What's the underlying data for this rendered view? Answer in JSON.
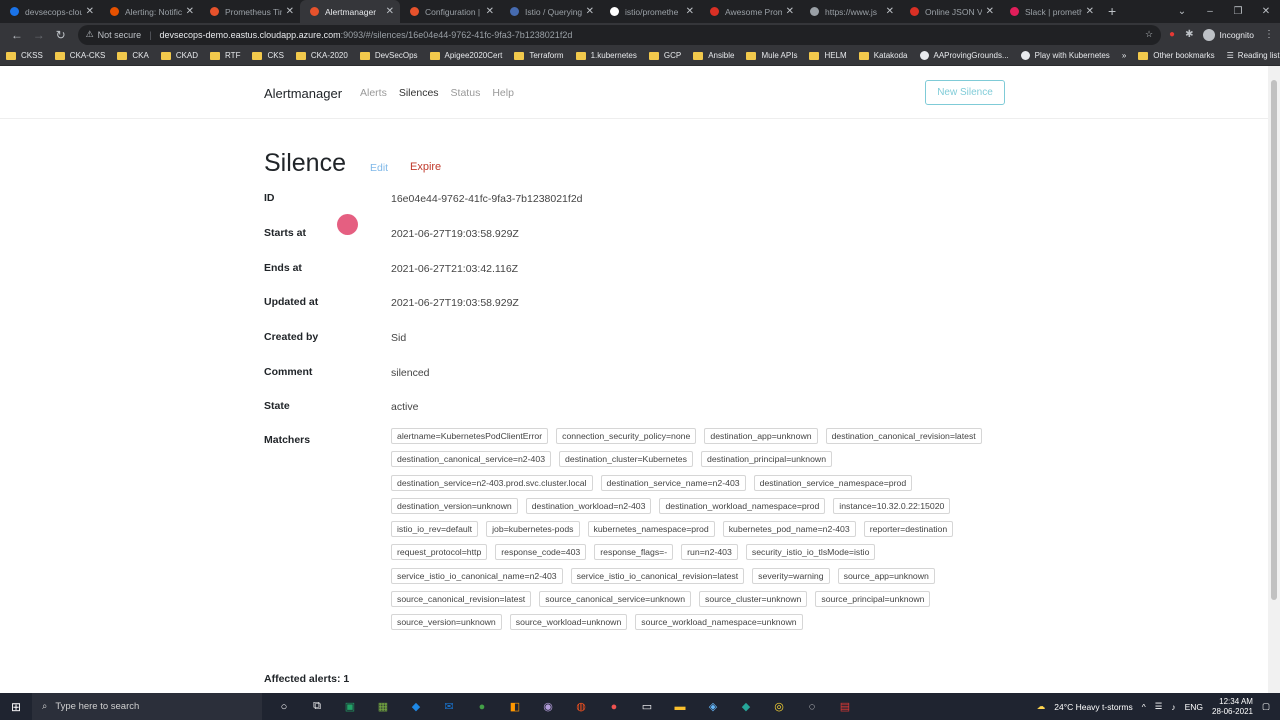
{
  "browser": {
    "tabs": [
      {
        "title": "devsecops-clou",
        "color": "#1a73e8"
      },
      {
        "title": "Alerting: Notific",
        "color": "#e65100"
      },
      {
        "title": "Prometheus Tim",
        "color": "#e6522c"
      },
      {
        "title": "Alertmanager",
        "color": "#e6522c"
      },
      {
        "title": "Configuration |",
        "color": "#e6522c"
      },
      {
        "title": "Istio / Querying",
        "color": "#466bb0"
      },
      {
        "title": "istio/promethe",
        "color": "#ffffff"
      },
      {
        "title": "Awesome Prom",
        "color": "#d93025"
      },
      {
        "title": "https://www.js",
        "color": "#9aa0a6"
      },
      {
        "title": "Online JSON Vie",
        "color": "#d93025"
      },
      {
        "title": "Slack | prometh",
        "color": "#e01e5a"
      }
    ],
    "new_tab": "+",
    "security_label": "Not secure",
    "url_host": "devsecops-demo.eastus.cloudapp.azure.com",
    "url_path": ":9093/#/silences/16e04e44-9762-41fc-9fa3-7b1238021f2d",
    "incognito_label": "Incognito",
    "bookmarks": [
      "CKSS",
      "CKA-CKS",
      "CKA",
      "CKAD",
      "RTF",
      "CKS",
      "CKA-2020",
      "DevSecOps",
      "Apigee2020Cert",
      "Terraform",
      "1.kubernetes",
      "GCP",
      "Ansible",
      "Mule APIs",
      "HELM",
      "Katakoda",
      "AAProvingGrounds...",
      "Play with Kubernetes"
    ],
    "bookmarks_overflow": "»",
    "other_bookmarks": "Other bookmarks",
    "reading_list": "Reading list"
  },
  "nav": {
    "brand": "Alertmanager",
    "links": [
      "Alerts",
      "Silences",
      "Status",
      "Help"
    ],
    "active": "Silences",
    "new_silence": "New Silence"
  },
  "silence": {
    "title": "Silence",
    "edit": "Edit",
    "expire": "Expire",
    "fields": [
      {
        "label": "ID",
        "value": "16e04e44-9762-41fc-9fa3-7b1238021f2d"
      },
      {
        "label": "Starts at",
        "value": "2021-06-27T19:03:58.929Z"
      },
      {
        "label": "Ends at",
        "value": "2021-06-27T21:03:42.116Z"
      },
      {
        "label": "Updated at",
        "value": "2021-06-27T19:03:58.929Z"
      },
      {
        "label": "Created by",
        "value": "Sid"
      },
      {
        "label": "Comment",
        "value": "silenced"
      },
      {
        "label": "State",
        "value": "active"
      }
    ],
    "matchers_label": "Matchers",
    "matchers": [
      "alertname=KubernetesPodClientError",
      "connection_security_policy=none",
      "destination_app=unknown",
      "destination_canonical_revision=latest",
      "destination_canonical_service=n2-403",
      "destination_cluster=Kubernetes",
      "destination_principal=unknown",
      "destination_service=n2-403.prod.svc.cluster.local",
      "destination_service_name=n2-403",
      "destination_service_namespace=prod",
      "destination_version=unknown",
      "destination_workload=n2-403",
      "destination_workload_namespace=prod",
      "instance=10.32.0.22:15020",
      "istio_io_rev=default",
      "job=kubernetes-pods",
      "kubernetes_namespace=prod",
      "kubernetes_pod_name=n2-403",
      "reporter=destination",
      "request_protocol=http",
      "response_code=403",
      "response_flags=-",
      "run=n2-403",
      "security_istio_io_tlsMode=istio",
      "service_istio_io_canonical_name=n2-403",
      "service_istio_io_canonical_revision=latest",
      "severity=warning",
      "source_app=unknown",
      "source_canonical_revision=latest",
      "source_canonical_service=unknown",
      "source_cluster=unknown",
      "source_principal=unknown",
      "source_version=unknown",
      "source_workload=unknown",
      "source_workload_namespace=unknown"
    ],
    "affected": "Affected alerts: 1"
  },
  "taskbar": {
    "search_placeholder": "Type here to search",
    "weather": "24°C  Heavy t-storms",
    "lang": "ENG",
    "time": "12:34 AM",
    "date": "28-06-2021"
  }
}
